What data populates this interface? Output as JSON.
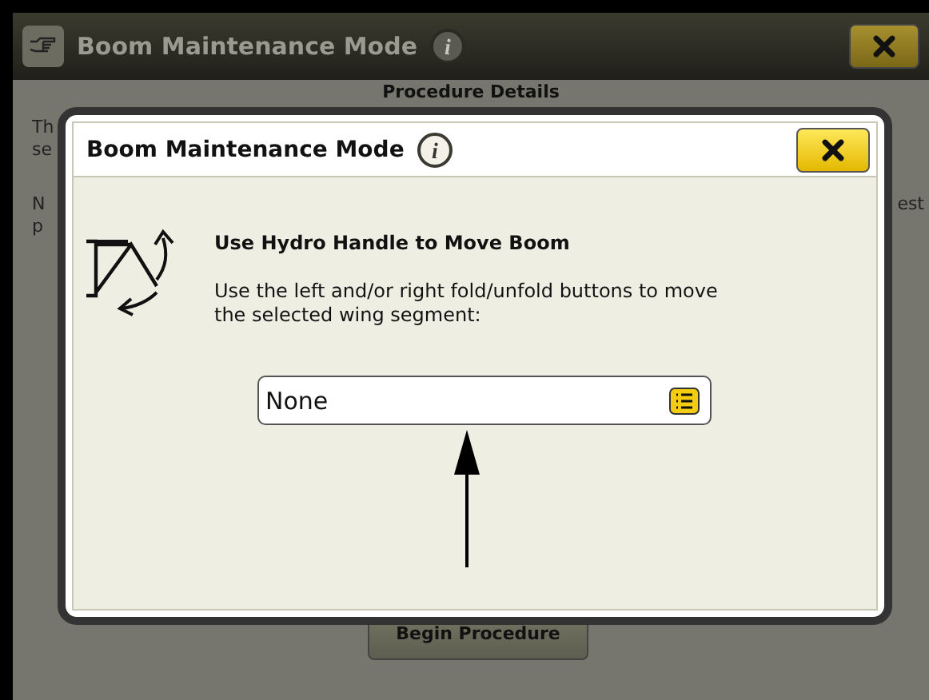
{
  "background_window": {
    "title": "Boom Maintenance Mode",
    "info_glyph": "i",
    "subheader": "Procedure Details",
    "text_fragments_left": [
      "Th",
      "se",
      "N",
      "p"
    ],
    "text_fragment_right": "est",
    "begin_button": "Begin Procedure"
  },
  "dialog": {
    "title": "Boom Maintenance Mode",
    "info_glyph": "i",
    "heading": "Use Hydro Handle to Move Boom",
    "instruction": "Use the left and/or right fold/unfold buttons to move the selected wing segment:",
    "segment_select": {
      "value": "None"
    }
  }
}
